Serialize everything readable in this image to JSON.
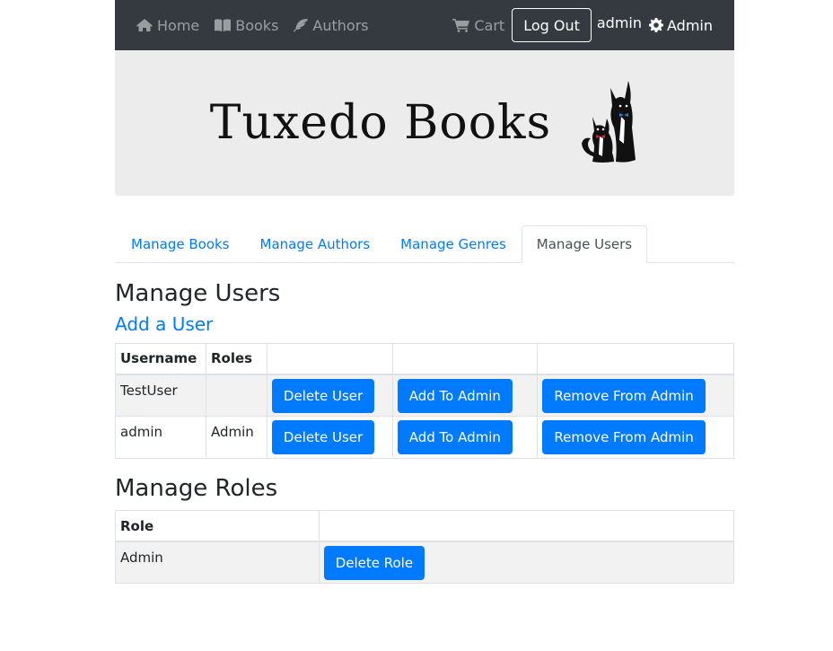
{
  "navbar": {
    "home": "Home",
    "books": "Books",
    "authors": "Authors",
    "cart": "Cart",
    "logout": "Log Out",
    "username": "admin",
    "admin": "Admin"
  },
  "banner": {
    "brand": "Tuxedo Books"
  },
  "tabs": [
    "Manage Books",
    "Manage Authors",
    "Manage Genres",
    "Manage Users"
  ],
  "active_tab": "Manage Users",
  "users_section": {
    "heading": "Manage Users",
    "add_link": "Add a User",
    "columns": [
      "Username",
      "Roles",
      "",
      "",
      ""
    ],
    "rows": [
      {
        "username": "TestUser",
        "roles": "",
        "delete": "Delete User",
        "add_admin": "Add To Admin",
        "remove_admin": "Remove From Admin"
      },
      {
        "username": "admin",
        "roles": "Admin",
        "delete": "Delete User",
        "add_admin": "Add To Admin",
        "remove_admin": "Remove From Admin"
      }
    ]
  },
  "roles_section": {
    "heading": "Manage Roles",
    "columns": [
      "Role",
      ""
    ],
    "rows": [
      {
        "role": "Admin",
        "delete": "Delete Role"
      }
    ]
  },
  "colors": {
    "navbar_bg": "#343a40",
    "link": "#007bff",
    "primary_button": "#007bff",
    "banner_bg": "#ececec"
  }
}
